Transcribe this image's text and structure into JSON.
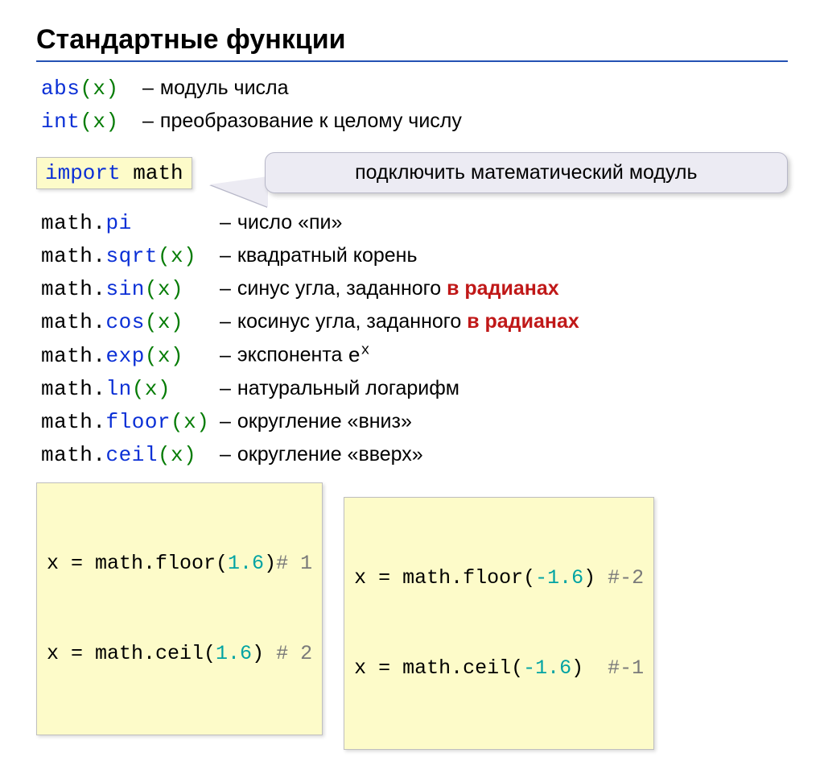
{
  "title": "Стандартные функции",
  "top": [
    {
      "fn_blue": "abs",
      "fn_green": "(x)",
      "desc": "модуль числа"
    },
    {
      "fn_blue": "int",
      "fn_green": "(x)",
      "desc": "преобразование к целому числу"
    }
  ],
  "import_stmt": {
    "kw": "import",
    "mod": "math"
  },
  "callout": "подключить математический модуль",
  "math_rows": [
    {
      "pre": "math.",
      "name": "pi",
      "args": "",
      "desc": "число «пи»",
      "red": ""
    },
    {
      "pre": "math.",
      "name": "sqrt",
      "args": "(x)",
      "desc": "квадратный корень",
      "red": ""
    },
    {
      "pre": "math.",
      "name": "sin",
      "args": "(x)",
      "desc": "синус угла, заданного ",
      "red": "в радианах"
    },
    {
      "pre": "math.",
      "name": "cos",
      "args": "(x)",
      "desc": "косинус угла, заданного ",
      "red": "в радианах"
    },
    {
      "pre": "math.",
      "name": "exp",
      "args": "(x)",
      "desc_html": "экспонента <span class=\"fn\">e<sup>x</sup></span>",
      "red": ""
    },
    {
      "pre": "math.",
      "name": "ln",
      "args": "(x)",
      "desc": "натуральный логарифм",
      "red": ""
    },
    {
      "pre": "math.",
      "name": "floor",
      "args": "(x)",
      "desc": "округление «вниз»",
      "red": ""
    },
    {
      "pre": "math.",
      "name": "ceil",
      "args": "(x)",
      "desc": "округление «вверх»",
      "red": ""
    }
  ],
  "examples_a": [
    {
      "code": "x = math.floor(",
      "num": "1.6",
      "tail": ")",
      "comment": "# 1"
    },
    {
      "code": "x = math.ceil(",
      "num": "1.6",
      "tail": ")",
      "comment": " # 2"
    }
  ],
  "examples_b": [
    {
      "code": "x = math.floor(",
      "num": "-1.6",
      "tail": ")",
      "comment": " #-2"
    },
    {
      "code": "x = math.ceil(",
      "num": "-1.6",
      "tail": ")",
      "comment": "  #-1"
    }
  ]
}
